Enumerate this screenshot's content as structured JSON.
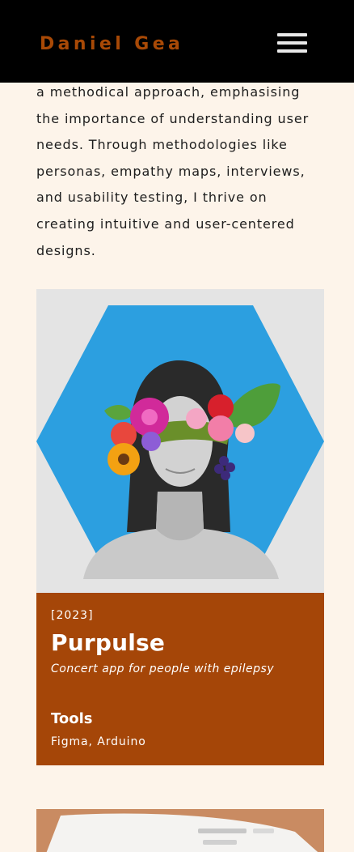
{
  "header": {
    "brand": "Daniel Gea",
    "menu_icon": "hamburger-menu-icon"
  },
  "intro": {
    "text": "a methodical approach, emphasising the importance of understanding user needs. Through methodologies like personas, empathy maps, interviews, and usability testing, I thrive on creating intuitive and user-centered designs."
  },
  "projects": [
    {
      "year": "[2023]",
      "title": "Purpulse",
      "subtitle": "Concert app for people with epilepsy",
      "tools_heading": "Tools",
      "tools": "Figma, Arduino",
      "image": "woman-with-flowers-over-eyes-on-blue-hexagon"
    }
  ],
  "colors": {
    "background": "#fdf4ea",
    "header": "#000000",
    "brand": "#a84906",
    "card": "#a54608",
    "hexagon": "#2c9fe0"
  }
}
